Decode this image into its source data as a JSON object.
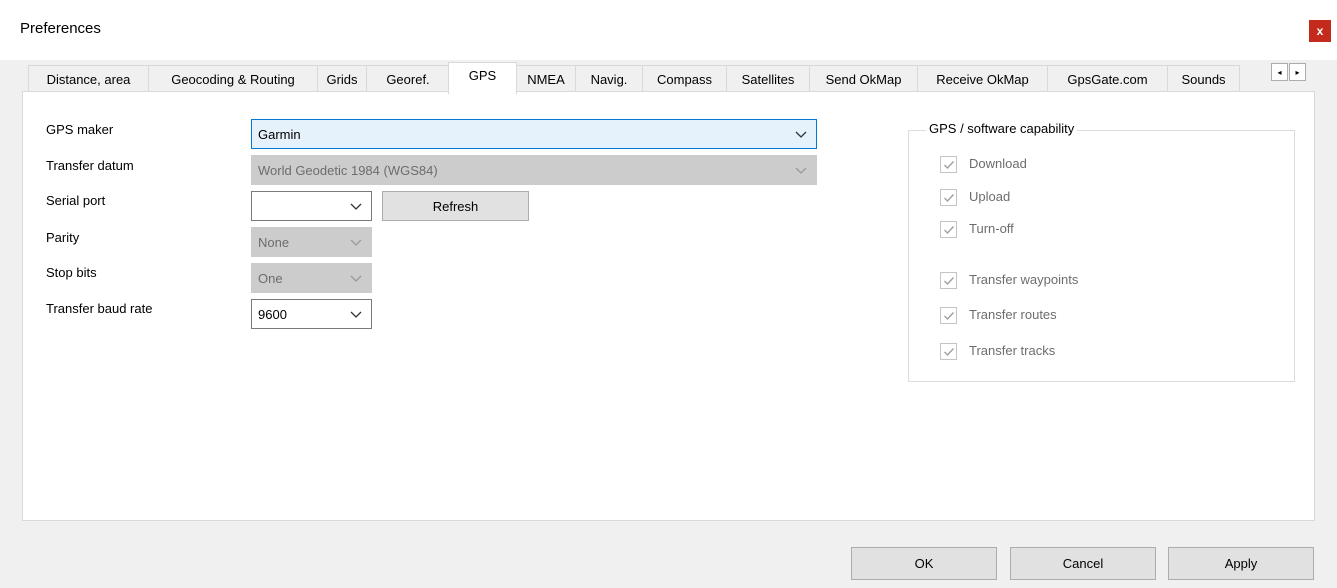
{
  "window": {
    "title": "Preferences",
    "close_glyph": "x"
  },
  "tabs": [
    {
      "label": "Distance, area"
    },
    {
      "label": "Geocoding & Routing"
    },
    {
      "label": "Grids"
    },
    {
      "label": "Georef."
    },
    {
      "label": "GPS",
      "active": true
    },
    {
      "label": "NMEA"
    },
    {
      "label": "Navig."
    },
    {
      "label": "Compass"
    },
    {
      "label": "Satellites"
    },
    {
      "label": "Send OkMap"
    },
    {
      "label": "Receive OkMap"
    },
    {
      "label": "GpsGate.com"
    },
    {
      "label": "Sounds"
    }
  ],
  "tab_scroll": {
    "left_glyph": "◂",
    "right_glyph": "▸"
  },
  "form": {
    "gps_maker": {
      "label": "GPS maker",
      "value": "Garmin"
    },
    "transfer_datum": {
      "label": "Transfer datum",
      "value": "World Geodetic 1984 (WGS84)"
    },
    "serial_port": {
      "label": "Serial port",
      "value": ""
    },
    "refresh_label": "Refresh",
    "parity": {
      "label": "Parity",
      "value": "None"
    },
    "stop_bits": {
      "label": "Stop bits",
      "value": "One"
    },
    "baud_rate": {
      "label": "Transfer baud rate",
      "value": "9600"
    }
  },
  "capability": {
    "title": "GPS / software capability",
    "items": [
      {
        "label": "Download",
        "checked": true
      },
      {
        "label": "Upload",
        "checked": true
      },
      {
        "label": "Turn-off",
        "checked": true
      },
      {
        "label": "Transfer waypoints",
        "checked": true
      },
      {
        "label": "Transfer routes",
        "checked": true
      },
      {
        "label": "Transfer tracks",
        "checked": true
      }
    ]
  },
  "footer": {
    "ok_label": "OK",
    "cancel_label": "Cancel",
    "apply_label": "Apply"
  },
  "colors": {
    "accent": "#0078d7",
    "close_bg": "#c42b1c",
    "disabled_bg": "#cccccc"
  }
}
